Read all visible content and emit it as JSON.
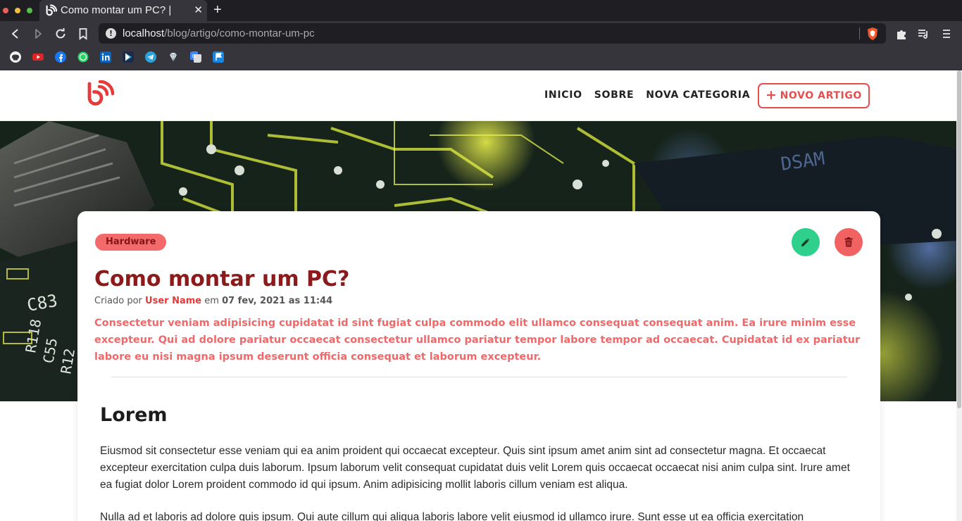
{
  "browser": {
    "tab_title": "Como montar um PC? | ",
    "tab_close": "✕",
    "new_tab": "+",
    "url_host": "localhost",
    "url_path": "/blog/artigo/como-montar-um-pc"
  },
  "bookmarks": [
    "github-icon",
    "youtube-icon",
    "facebook-icon",
    "whatsapp-icon",
    "linkedin-icon",
    "google-play-icon",
    "telegram-icon",
    "gem-icon",
    "google-translate-icon",
    "flag-icon"
  ],
  "nav": {
    "links": [
      "INICIO",
      "SOBRE",
      "NOVA CATEGORIA"
    ],
    "new_article": "NOVO ARTIGO",
    "plus": "+"
  },
  "article": {
    "category": "Hardware",
    "title": "Como montar um PC?",
    "meta_prefix": "Criado por",
    "author": "User Name",
    "meta_mid": "em",
    "date": "07 fev, 2021 as 11:44",
    "lead": "Consectetur veniam adipisicing cupidatat id sint fugiat culpa commodo elit ullamco consequat consequat anim. Ea irure minim esse excepteur. Qui ad dolore pariatur occaecat consectetur ullamco pariatur tempor labore tempor ad occaecat. Cupidatat id ex pariatur labore eu nisi magna ipsum deserunt officia consequat et laborum excepteur.",
    "heading": "Lorem",
    "paragraphs": [
      "Eiusmod sit consectetur esse veniam qui ea anim proident qui occaecat excepteur. Quis sint ipsum amet anim sint ad consectetur magna. Et occaecat excepteur exercitation culpa duis laborum. Ipsum laborum velit consequat cupidatat duis velit Lorem quis occaecat occaecat nisi anim culpa sint. Irure amet ea fugiat dolor Lorem proident commodo id qui ipsum. Anim adipisicing mollit laboris cillum veniam est aliqua.",
      "Nulla ad et laboris ad dolore quis ipsum. Qui aute cillum qui aliqua laboris labore velit eiusmod id ullamco irure. Sunt esse ut ea officia exercitation"
    ]
  },
  "colors": {
    "brand_red": "#e54e4e",
    "title_red": "#8b1a1a",
    "badge_bg": "#f26a6a",
    "edit_green": "#2fcf8c",
    "delete_red": "#f16262"
  }
}
